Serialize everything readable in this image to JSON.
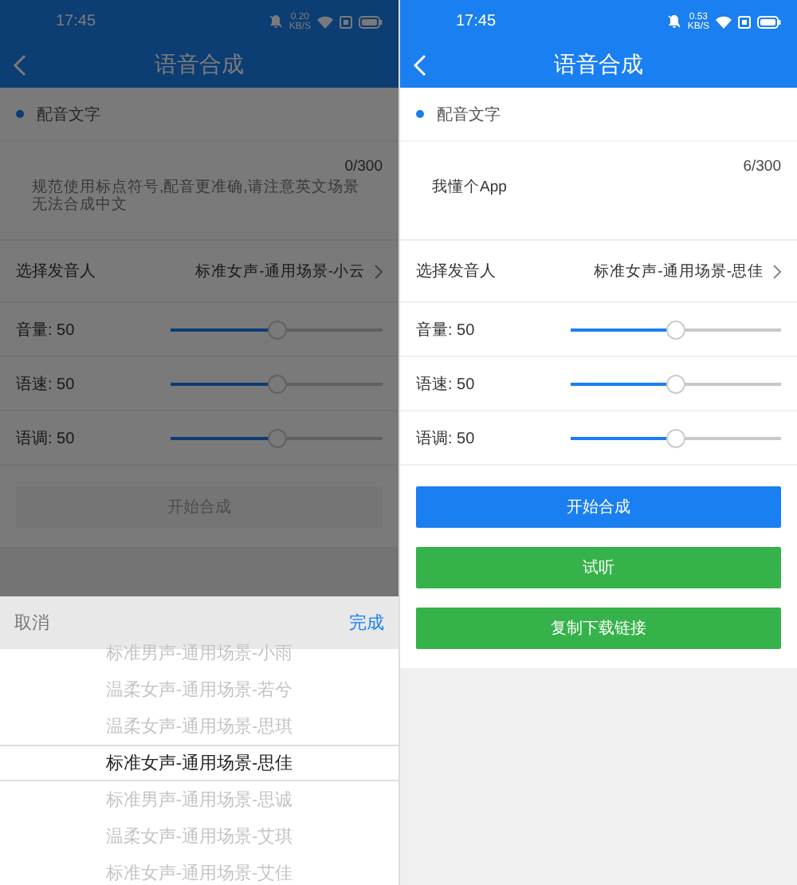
{
  "screens": [
    {
      "dimmed": true,
      "status_bar": {
        "time": "17:45",
        "speed": "0.20",
        "speed_unit": "KB/S"
      },
      "title": "语音合成",
      "section_label": "配音文字",
      "text_field": {
        "placeholder": "规范使用标点符号,配音更准确,请注意英文场景无法合成中文",
        "counter": "0/300"
      },
      "voice": {
        "label": "选择发音人",
        "value": "标准女声-通用场景-小云"
      },
      "sliders": [
        {
          "label": "音量: 50",
          "level": 0.5
        },
        {
          "label": "语速: 50",
          "level": 0.5
        },
        {
          "label": "语调: 50",
          "level": 0.5
        }
      ],
      "buttons": [
        {
          "label": "开始合成",
          "kind": "primary",
          "disabled": true
        }
      ],
      "picker": {
        "cancel": "取消",
        "done": "完成",
        "options": [
          {
            "label": "标准男声-通用场景-小雨",
            "selected": false
          },
          {
            "label": "温柔女声-通用场景-若兮",
            "selected": false
          },
          {
            "label": "温柔女声-通用场景-思琪",
            "selected": false
          },
          {
            "label": "标准女声-通用场景-思佳",
            "selected": true
          },
          {
            "label": "标准男声-通用场景-思诚",
            "selected": false
          },
          {
            "label": "温柔女声-通用场景-艾琪",
            "selected": false
          },
          {
            "label": "标准女声-通用场景-艾佳",
            "selected": false
          }
        ]
      }
    },
    {
      "dimmed": false,
      "status_bar": {
        "time": "17:45",
        "speed": "0.53",
        "speed_unit": "KB/S"
      },
      "title": "语音合成",
      "section_label": "配音文字",
      "text_field": {
        "value": "我懂个App",
        "counter": "6/300"
      },
      "voice": {
        "label": "选择发音人",
        "value": "标准女声-通用场景-思佳"
      },
      "sliders": [
        {
          "label": "音量: 50",
          "level": 0.5
        },
        {
          "label": "语速: 50",
          "level": 0.5
        },
        {
          "label": "语调: 50",
          "level": 0.5
        }
      ],
      "buttons": [
        {
          "label": "开始合成",
          "kind": "primary",
          "disabled": false
        },
        {
          "label": "试听",
          "kind": "secondary",
          "disabled": false
        },
        {
          "label": "复制下载链接",
          "kind": "secondary",
          "disabled": false
        }
      ]
    }
  ]
}
